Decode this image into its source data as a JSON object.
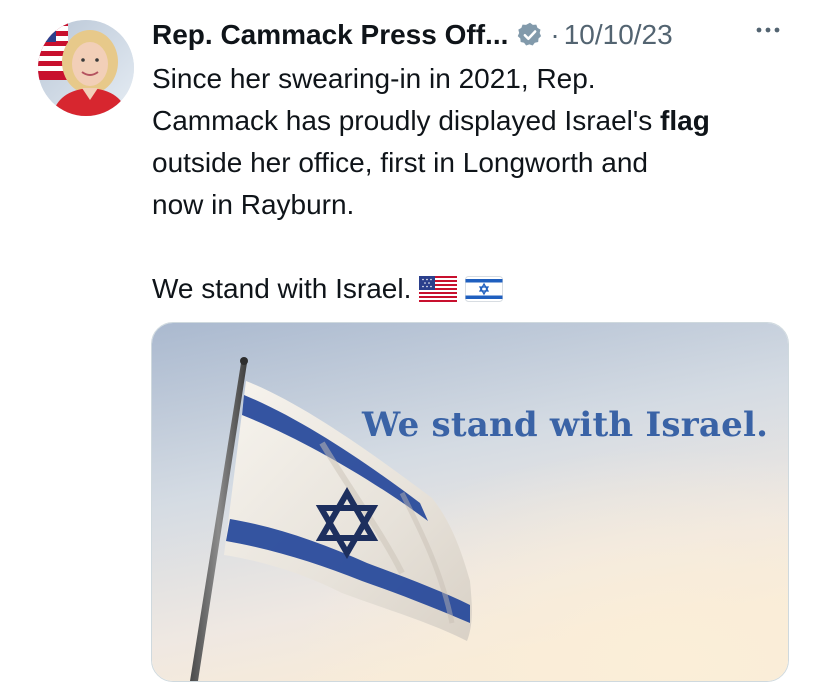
{
  "tweet": {
    "author_name": "Rep. Cammack Press Off...",
    "separator": "·",
    "date": "10/10/23",
    "text_lines": {
      "line1": "Since her swearing-in in 2021, Rep.",
      "line2_pre": "Cammack has proudly displayed Israel's ",
      "line2_bold": "flag",
      "line3": "outside her office, first in Longworth and",
      "line4": "now in Rayburn.",
      "line5": "We stand with Israel."
    },
    "emojis": [
      "us-flag-icon",
      "israel-flag-icon"
    ],
    "media": {
      "caption": "We stand with Israel."
    }
  },
  "colors": {
    "text_primary": "#0f1419",
    "text_secondary": "#536471",
    "verified_badge": "#829aab",
    "caption": "#3a63a6",
    "flag_blue": "#1f3f8f",
    "border": "#cfd9de"
  }
}
